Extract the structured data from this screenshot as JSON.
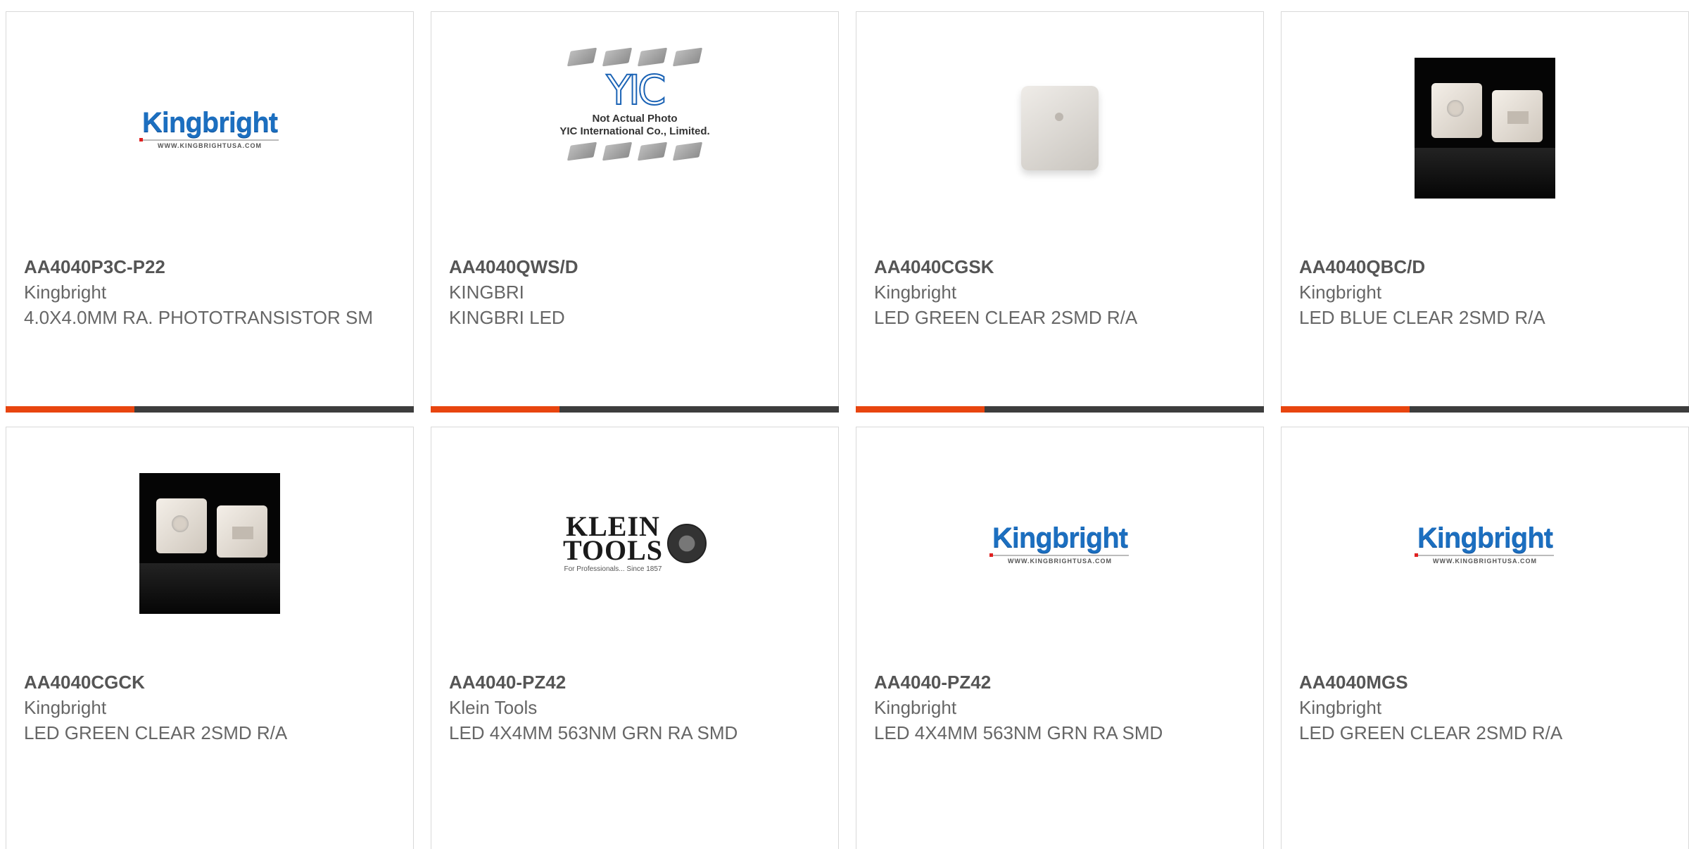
{
  "colors": {
    "bar_dark": "#3d3d3d",
    "bar_accent": "#e8450f",
    "text": "#666666"
  },
  "products": [
    {
      "part": "AA4040P3C-P22",
      "mfr": "Kingbright",
      "desc": "4.0X4.0MM RA. PHOTOTRANSISTOR SM",
      "image": "kingbright-logo"
    },
    {
      "part": "AA4040QWS/D",
      "mfr": "KINGBRI",
      "desc": "KINGBRI LED",
      "image": "yic-placeholder"
    },
    {
      "part": "AA4040CGSK",
      "mfr": "Kingbright",
      "desc": "LED GREEN CLEAR 2SMD R/A",
      "image": "led-photo-white"
    },
    {
      "part": "AA4040QBC/D",
      "mfr": "Kingbright",
      "desc": "LED BLUE CLEAR 2SMD R/A",
      "image": "led-photo-black"
    },
    {
      "part": "AA4040CGCK",
      "mfr": "Kingbright",
      "desc": "LED GREEN CLEAR 2SMD R/A",
      "image": "led-photo-black"
    },
    {
      "part": "AA4040-PZ42",
      "mfr": "Klein Tools",
      "desc": "LED 4X4MM 563NM GRN RA SMD",
      "image": "klein-logo"
    },
    {
      "part": "AA4040-PZ42",
      "mfr": "Kingbright",
      "desc": "LED 4X4MM 563NM GRN RA SMD",
      "image": "kingbright-logo"
    },
    {
      "part": "AA4040MGS",
      "mfr": "Kingbright",
      "desc": "LED GREEN CLEAR 2SMD R/A",
      "image": "kingbright-logo"
    }
  ],
  "logos": {
    "kingbright": {
      "word": "Kingbright",
      "url": "WWW.KINGBRIGHTUSA.COM"
    },
    "yic": {
      "mark": "YIC",
      "line1": "Not Actual Photo",
      "line2": "YIC International Co., Limited."
    },
    "klein": {
      "line1": "KLEIN",
      "line2": "TOOLS",
      "tagline": "For Professionals... Since 1857"
    }
  }
}
